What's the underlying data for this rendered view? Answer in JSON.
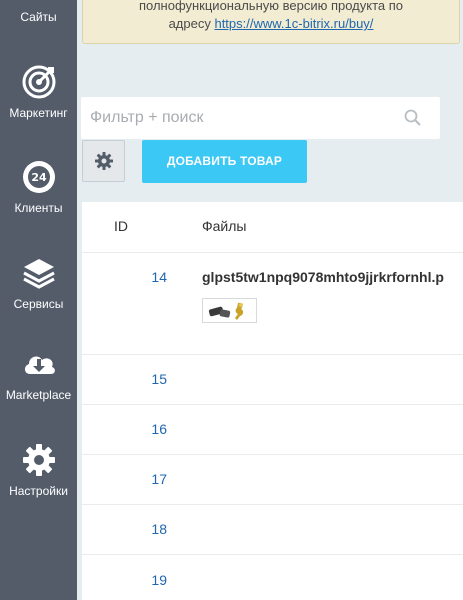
{
  "sidebar": {
    "items": [
      {
        "label": "Сайты",
        "icon": "sites-icon"
      },
      {
        "label": "Маркетинг",
        "icon": "target-icon"
      },
      {
        "label": "Клиенты",
        "icon": "clock-24-icon"
      },
      {
        "label": "Сервисы",
        "icon": "layers-icon"
      },
      {
        "label": "Marketplace",
        "icon": "cloud-download-icon"
      },
      {
        "label": "Настройки",
        "icon": "gear-icon"
      }
    ]
  },
  "notice": {
    "line1": "полнофункциональную версию продукта по",
    "line2_prefix": "адресу ",
    "link": "https://www.1c-bitrix.ru/buy/"
  },
  "filter": {
    "placeholder": "Фильтр + поиск",
    "value": ""
  },
  "toolbar": {
    "add_label": "ДОБАВИТЬ ТОВАР"
  },
  "table": {
    "headers": {
      "id": "ID",
      "files": "Файлы"
    },
    "rows": [
      {
        "id": "14",
        "file": "glpst5tw1npq9078mhto9jjrkrfornhl.p"
      },
      {
        "id": "15",
        "file": ""
      },
      {
        "id": "16",
        "file": ""
      },
      {
        "id": "17",
        "file": ""
      },
      {
        "id": "18",
        "file": ""
      },
      {
        "id": "19",
        "file": ""
      }
    ]
  },
  "colors": {
    "sidebar_bg": "#545c6a",
    "accent": "#3bc8f5",
    "link": "#2067b0",
    "notice_bg": "#f1ecd2"
  }
}
